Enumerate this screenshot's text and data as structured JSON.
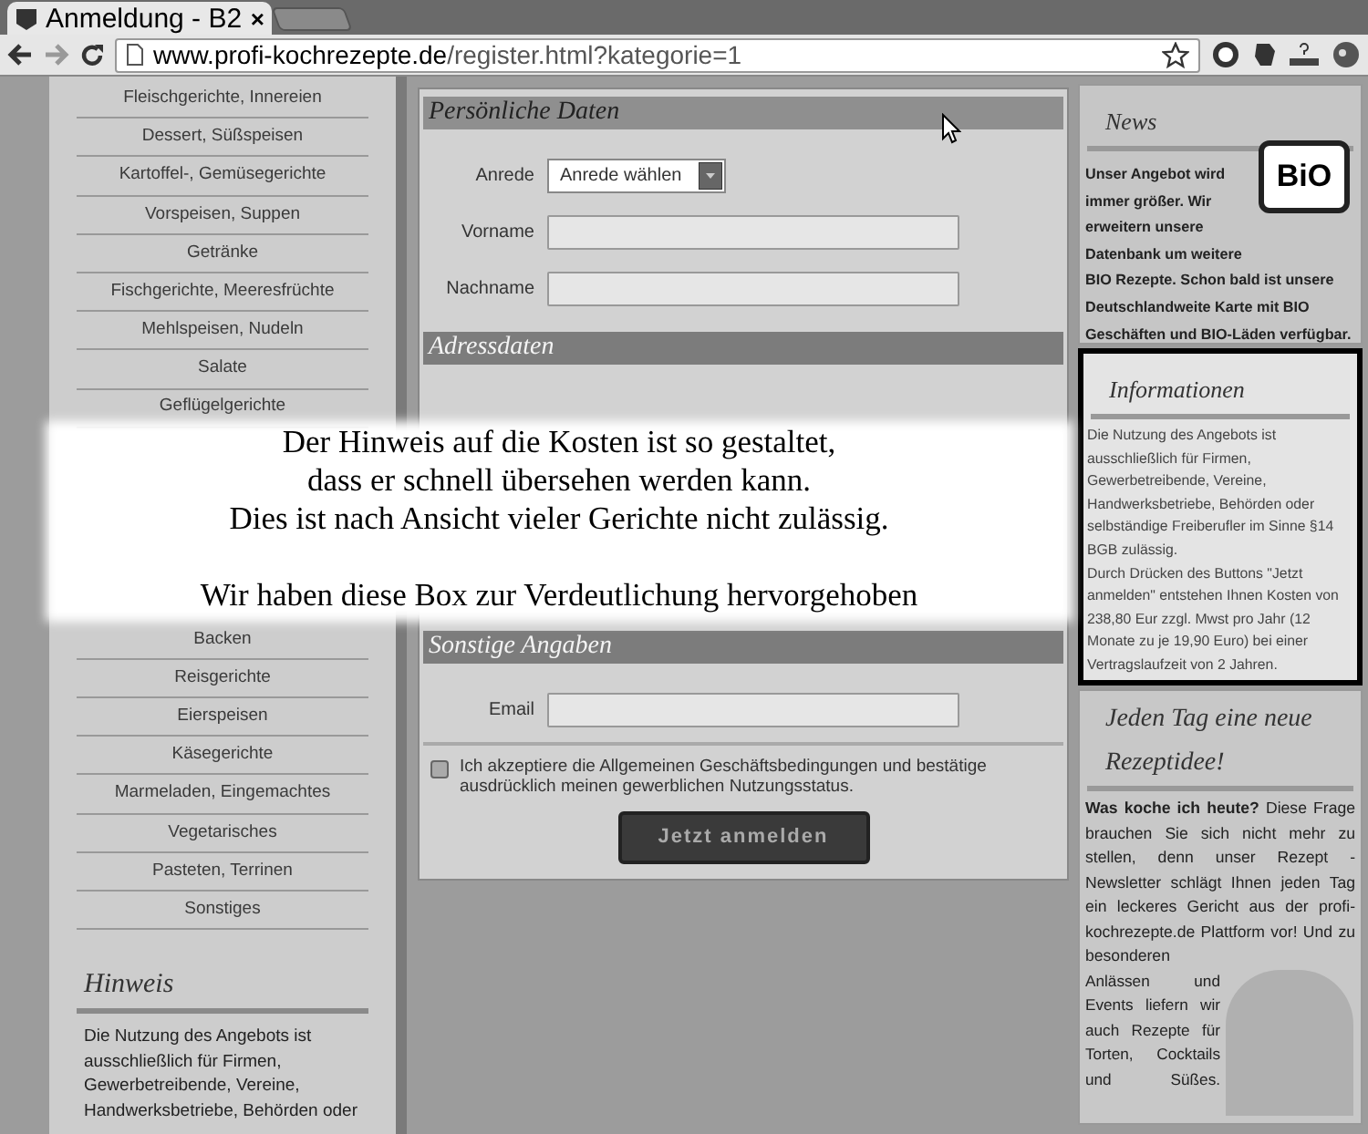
{
  "browser": {
    "tab_title": "Anmeldung - B2",
    "tab_close": "×",
    "url_domain": "www.profi-kochrezepte.de",
    "url_path": "/register.html?kategorie=1"
  },
  "sidebar": {
    "items_top": [
      {
        "label": "Fleischgerichte, Innereien"
      },
      {
        "label": "Dessert, Süßspeisen"
      },
      {
        "label": "Kartoffel-, Gemüsegerichte"
      },
      {
        "label": "Vorspeisen, Suppen"
      },
      {
        "label": "Getränke"
      },
      {
        "label": "Fischgerichte, Meeresfrüchte"
      },
      {
        "label": "Mehlspeisen, Nudeln"
      },
      {
        "label": "Salate"
      },
      {
        "label": "Geflügelgerichte"
      }
    ],
    "items_bottom": [
      {
        "label": "Backen"
      },
      {
        "label": "Reisgerichte"
      },
      {
        "label": "Eierspeisen"
      },
      {
        "label": "Käsegerichte"
      },
      {
        "label": "Marmeladen, Eingemachtes"
      },
      {
        "label": "Vegetarisches"
      },
      {
        "label": "Pasteten, Terrinen"
      },
      {
        "label": "Sonstiges"
      }
    ],
    "notice": {
      "title": "Hinweis",
      "text": "Die Nutzung des Angebots ist ausschließlich für Firmen, Gewerbetreibende, Vereine, Handwerksbetriebe, Behörden oder"
    }
  },
  "form": {
    "sections": [
      {
        "title": "Persönliche Daten",
        "fields": [
          {
            "kind": "select",
            "label": "Anrede",
            "value": "Anrede wählen"
          },
          {
            "kind": "text",
            "label": "Vorname"
          },
          {
            "kind": "text",
            "label": "Nachname"
          }
        ]
      },
      {
        "title": "Adressdaten"
      },
      {
        "title": "Sonstige Angaben",
        "fields": [
          {
            "kind": "text",
            "label": "Email"
          }
        ]
      }
    ],
    "terms": {
      "checked": false,
      "text": "Ich akzeptiere die Allgemeinen Geschäftsbedingungen und bestätige ausdrücklich meinen gewerblichen Nutzungsstatus."
    },
    "submit": "Jetzt anmelden"
  },
  "right": {
    "news": {
      "title": "News",
      "lines": [
        "Unser Angebot wird",
        "immer größer. Wir",
        "erweitern unsere",
        "Datenbank um weitere",
        "BIO Rezepte. Schon bald ist unsere",
        "Deutschlandweite Karte mit BIO",
        "Geschäften und BIO-Läden verfügbar."
      ],
      "badge": "BiO"
    },
    "info": {
      "title": "Informationen",
      "highlighted": true,
      "text": "Die Nutzung des Angebots ist ausschließlich für Firmen, Gewerbetreibende, Vereine, Handwerksbetriebe, Behörden oder selbständige Freiberufler im Sinne §14 BGB zulässig.",
      "text2": "Durch Drücken des Buttons \"Jetzt anmelden\" entstehen Ihnen Kosten von 238,80 Eur zzgl. Mwst pro Jahr (12 Monate zu je 19,90 Euro) bei einer Vertragslaufzeit von 2 Jahren."
    },
    "daily": {
      "title": "Jeden Tag eine neue Rezeptidee!",
      "text": "**Was koche ich heute?** Diese Frage brauchen Sie sich nicht mehr zu stellen, denn unser Rezept - Newsletter schlägt Ihnen jeden Tag ein leckeres Gericht aus der profi-kochrezepte.de Plattform vor! Und zu besonderen",
      "text2": "Anlässen und Events liefern wir auch Rezepte für Torten, Cocktails und Süßes."
    }
  },
  "annotation": {
    "lines": [
      "Der Hinweis auf die Kosten ist so gestaltet,",
      "dass er schnell übersehen werden kann.",
      "Dies ist nach Ansicht vieler Gerichte nicht zulässig."
    ],
    "note": "Wir haben diese Box zur Verdeutlichung hervorgehoben"
  }
}
